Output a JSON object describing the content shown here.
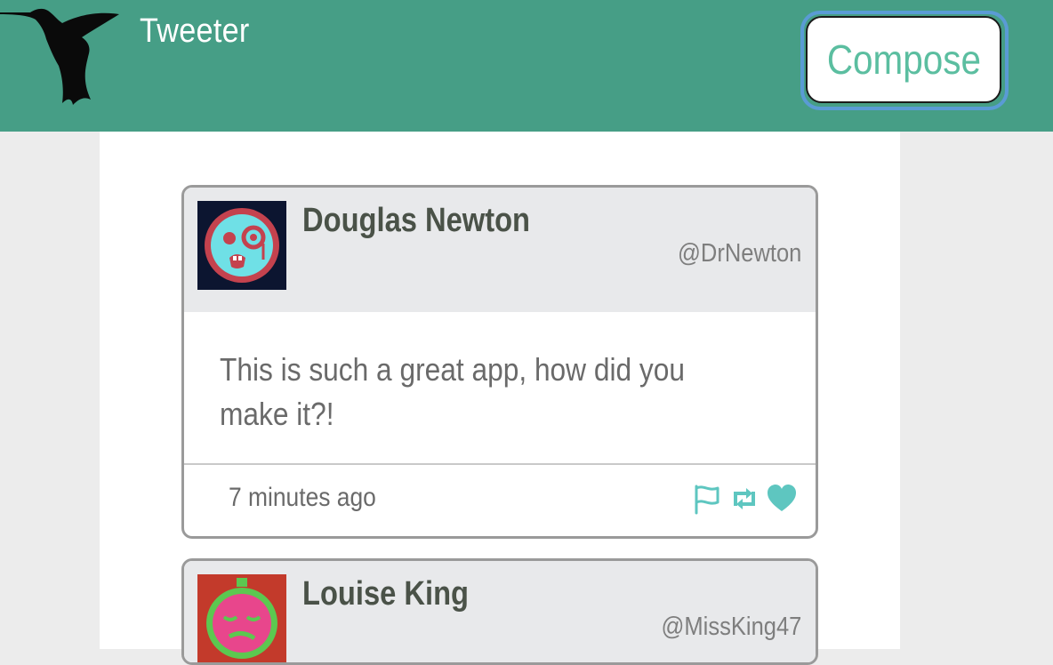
{
  "header": {
    "app_title": "Tweeter",
    "compose_label": "Compose"
  },
  "colors": {
    "header_bg": "#469e86",
    "accent": "#5bbea0",
    "action_icon": "#5ec6c0"
  },
  "tweets": [
    {
      "name": "Douglas Newton",
      "handle": "@DrNewton",
      "text": "This is such a great app, how did you make it?!",
      "timestamp": "7 minutes ago",
      "avatar_icon": "monocle-face-avatar",
      "actions": [
        "flag-icon",
        "retweet-icon",
        "heart-icon"
      ]
    },
    {
      "name": "Louise King",
      "handle": "@MissKing47",
      "avatar_icon": "sleepy-face-avatar"
    }
  ]
}
